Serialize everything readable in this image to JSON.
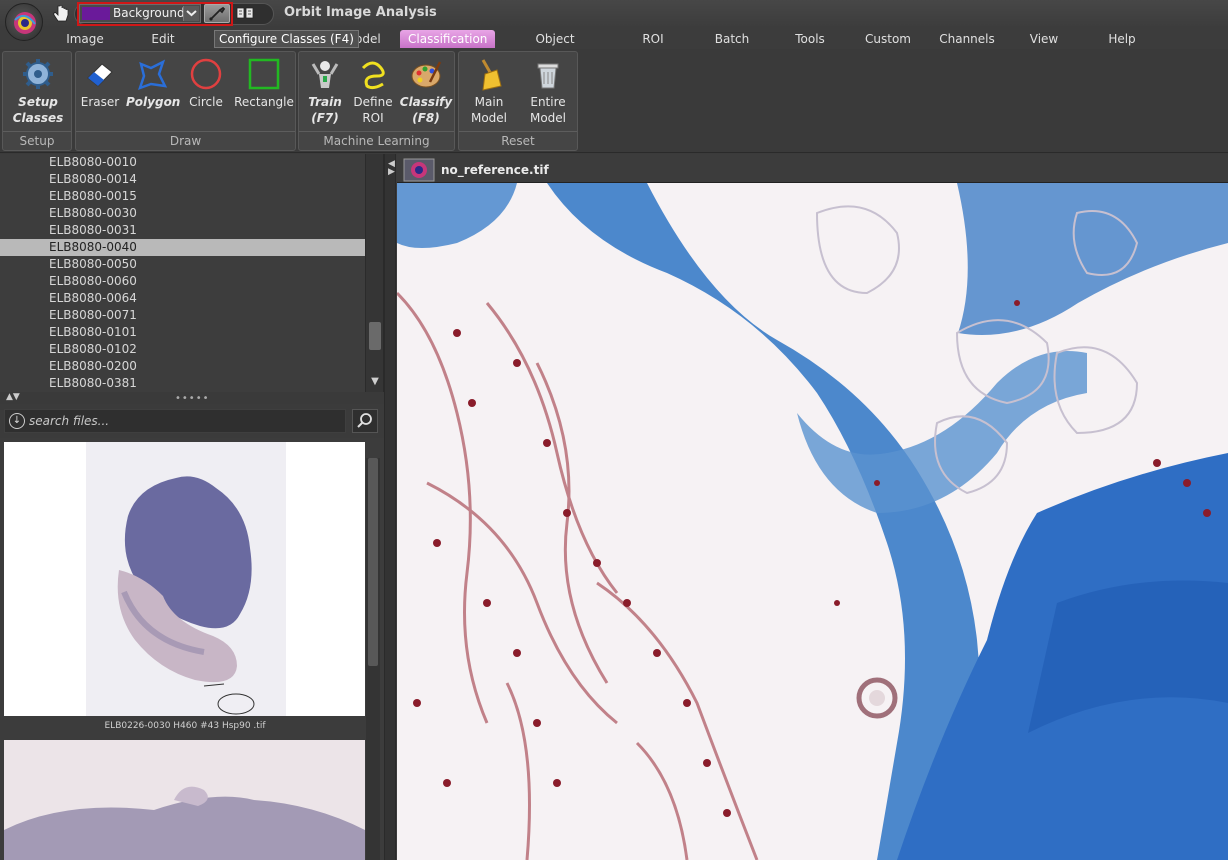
{
  "app": {
    "title": "Orbit Image Analysis",
    "class_select_value": "Background",
    "class_color": "#6a1a9a",
    "tooltip": "Configure Classes (F4)"
  },
  "menu": [
    {
      "label": "Image"
    },
    {
      "label": "Edit"
    },
    {
      "label": "n Model"
    },
    {
      "label": "Classification",
      "active": true
    },
    {
      "label": "Object Detection"
    },
    {
      "label": "ROI"
    },
    {
      "label": "Batch"
    },
    {
      "label": "Tools"
    },
    {
      "label": "Custom"
    },
    {
      "label": "Channels"
    },
    {
      "label": "View"
    },
    {
      "label": "Help"
    }
  ],
  "ribbon": {
    "setup": {
      "label": "Setup",
      "button": "Setup\nClasses"
    },
    "draw": {
      "label": "Draw",
      "eraser": "Eraser",
      "polygon": "Polygon",
      "circle": "Circle",
      "rectangle": "Rectangle"
    },
    "ml": {
      "label": "Machine Learning",
      "train": "Train",
      "train_key": "(F7)",
      "define": "Define",
      "define2": "ROI",
      "classify": "Classify",
      "classify_key": "(F8)"
    },
    "reset": {
      "label": "Reset",
      "main": "Main",
      "main2": "Model",
      "entire": "Entire",
      "entire2": "Model"
    }
  },
  "files": [
    "ELB8080-0010",
    "ELB8080-0014",
    "ELB8080-0015",
    "ELB8080-0030",
    "ELB8080-0031",
    "ELB8080-0040",
    "ELB8080-0050",
    "ELB8080-0060",
    "ELB8080-0064",
    "ELB8080-0071",
    "ELB8080-0101",
    "ELB8080-0102",
    "ELB8080-0200",
    "ELB8080-0381"
  ],
  "selected_file": "ELB8080-0040",
  "search": {
    "placeholder": "search files..."
  },
  "thumbnails": [
    {
      "caption": "ELB0226-0030 H460 #43 Hsp90 .tif"
    }
  ],
  "viewer": {
    "tab_title": "no_reference.tif"
  }
}
